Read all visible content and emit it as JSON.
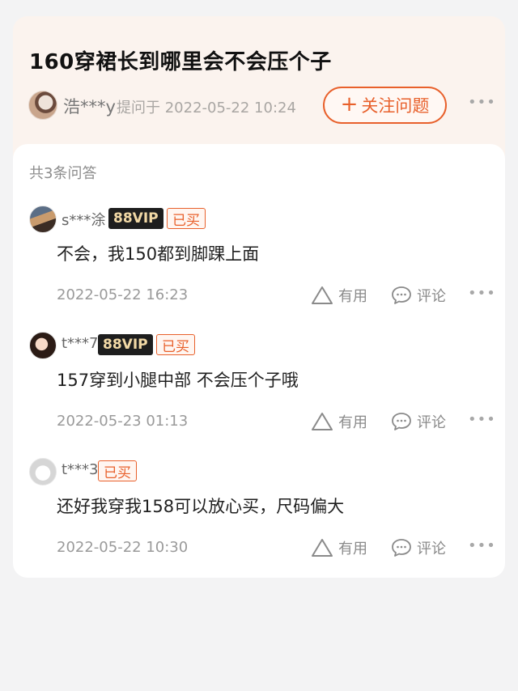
{
  "question": {
    "title": "160穿裙长到哪里会不会压个子",
    "asker": "浩***y",
    "asked_at": "提问于 2022-05-22 10:24",
    "follow_label": "关注问题",
    "more": "•••"
  },
  "answers": {
    "count_label": "共3条问答",
    "useful_label": "有用",
    "comment_label": "评论",
    "more": "•••",
    "vip_label": "88VIP",
    "bought_label": "已买",
    "items": [
      {
        "user": "s***涂",
        "vip": true,
        "bought": true,
        "text": "不会，我150都到脚踝上面",
        "date": "2022-05-22 16:23"
      },
      {
        "user": "t***7",
        "vip": true,
        "bought": true,
        "text": "157穿到小腿中部 不会压个子哦",
        "date": "2022-05-23 01:13"
      },
      {
        "user": "t***3",
        "vip": false,
        "bought": true,
        "text": "还好我穿我158可以放心买，尺码偏大",
        "date": "2022-05-22 10:30"
      }
    ]
  },
  "colors": {
    "accent": "#e8602b",
    "card_bg": "#fbf3ee",
    "vip_bg": "#1e1e1e",
    "vip_text": "#f2d9a6"
  },
  "icons": {
    "useful": "triangle-up-icon",
    "comment": "speech-bubble-icon",
    "follow": "plus-icon"
  }
}
